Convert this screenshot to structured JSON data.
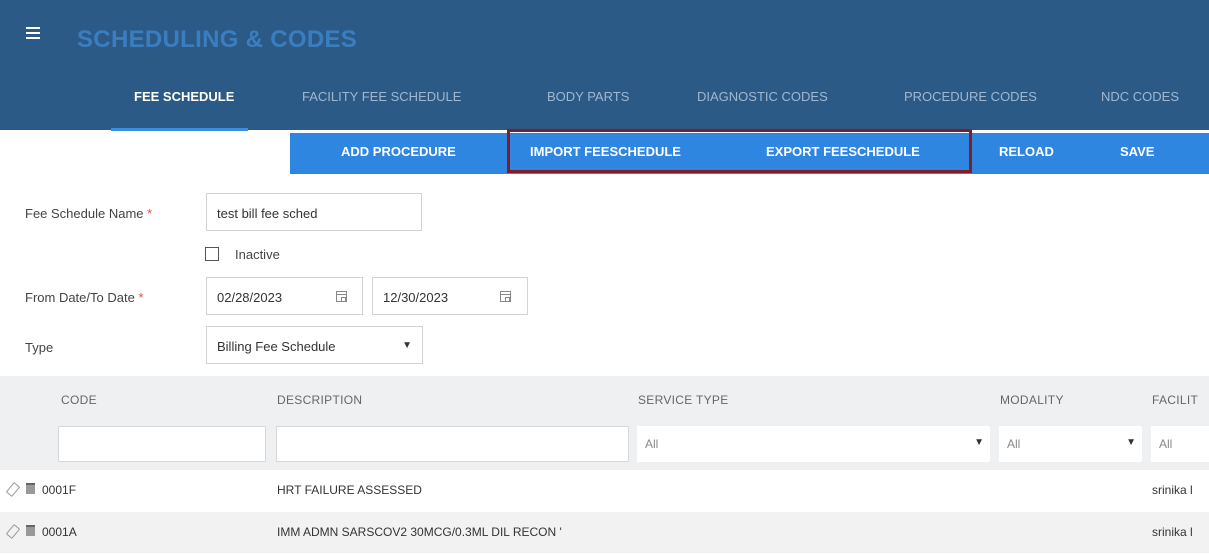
{
  "app": {
    "title": "SCHEDULING & CODES"
  },
  "tabs": [
    {
      "label": "FEE SCHEDULE",
      "active": true
    },
    {
      "label": "FACILITY FEE SCHEDULE"
    },
    {
      "label": "BODY PARTS"
    },
    {
      "label": "DIAGNOSTIC CODES"
    },
    {
      "label": "PROCEDURE CODES"
    },
    {
      "label": "NDC CODES"
    }
  ],
  "toolbar": {
    "add_procedure": "ADD PROCEDURE",
    "import": "IMPORT FEESCHEDULE",
    "export": "EXPORT FEESCHEDULE",
    "reload": "RELOAD",
    "save": "SAVE"
  },
  "form": {
    "name_label": "Fee Schedule Name",
    "required_mark": "*",
    "name_value": "test bill fee sched",
    "inactive_label": "Inactive",
    "date_label": "From Date/To Date",
    "from_date": "02/28/2023",
    "to_date": "12/30/2023",
    "type_label": "Type",
    "type_value": "Billing Fee Schedule"
  },
  "grid": {
    "columns": [
      "CODE",
      "DESCRIPTION",
      "SERVICE TYPE",
      "MODALITY",
      "FACILIT"
    ],
    "filters": {
      "service_type": "All",
      "modality": "All",
      "facility": "All"
    },
    "rows": [
      {
        "code": "0001F",
        "description": "HRT FAILURE ASSESSED",
        "facility": "srinika l"
      },
      {
        "code": "0001A",
        "description": "IMM ADMN SARSCOV2 30MCG/0.3ML DIL RECON '",
        "facility": "srinika l"
      }
    ]
  },
  "colors": {
    "header": "#2b5a86",
    "toolbar": "#2f86e0",
    "highlight": "#7d1f2b",
    "active_tab_underline": "#3b8de0"
  }
}
